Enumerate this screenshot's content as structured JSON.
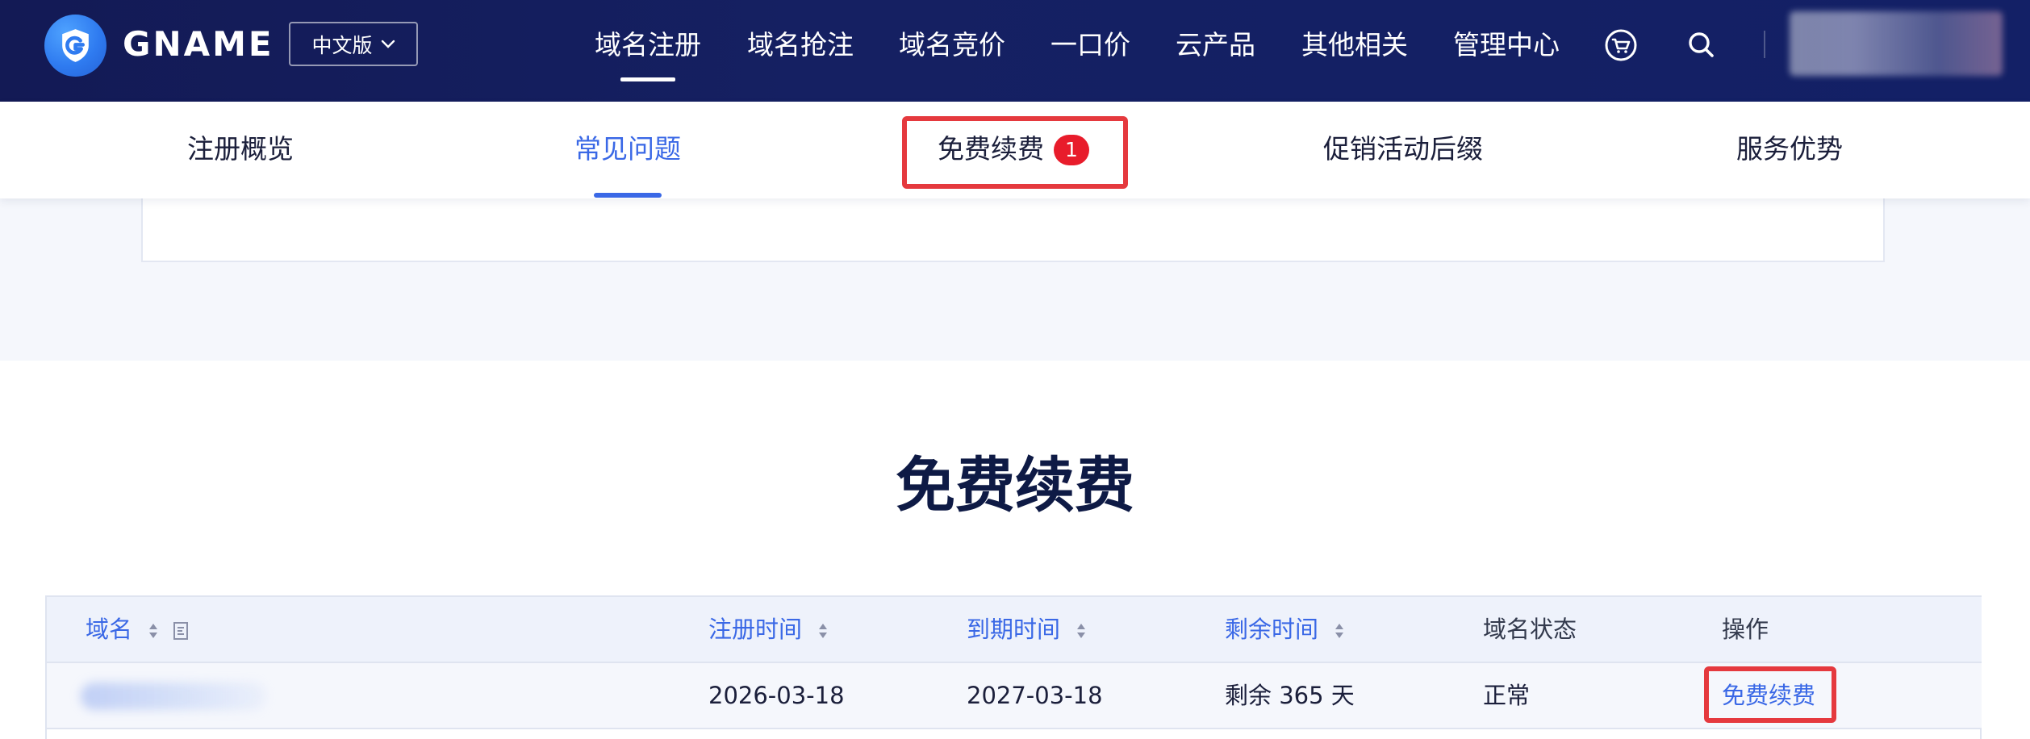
{
  "brand": {
    "name": "GNAME"
  },
  "lang_switch": {
    "label": "中文版"
  },
  "nav": {
    "items": [
      {
        "label": "域名注册",
        "active": true
      },
      {
        "label": "域名抢注"
      },
      {
        "label": "域名竞价"
      },
      {
        "label": "一口价"
      },
      {
        "label": "云产品"
      },
      {
        "label": "其他相关"
      },
      {
        "label": "管理中心"
      }
    ],
    "icons": [
      "cart-icon",
      "search-icon"
    ]
  },
  "subtabs": {
    "items": [
      {
        "label": "注册概览"
      },
      {
        "label": "常见问题",
        "active": true
      },
      {
        "label": "免费续费",
        "badge": "1"
      },
      {
        "label": "促销活动后缀"
      },
      {
        "label": "服务优势"
      }
    ]
  },
  "section": {
    "title": "免费续费"
  },
  "table": {
    "headers": [
      "域名",
      "注册时间",
      "到期时间",
      "剩余时间",
      "域名状态",
      "操作"
    ],
    "rows": [
      {
        "register_time": "2026-03-18",
        "expire_time": "2027-03-18",
        "remaining": "剩余 365 天",
        "status": "正常",
        "action": "免费续费"
      }
    ]
  },
  "colors": {
    "nav_bg": "#141d5e",
    "accent": "#3a68e6",
    "highlight": "#e5393e",
    "badge": "#e81c2b",
    "title": "#0e1a45"
  }
}
